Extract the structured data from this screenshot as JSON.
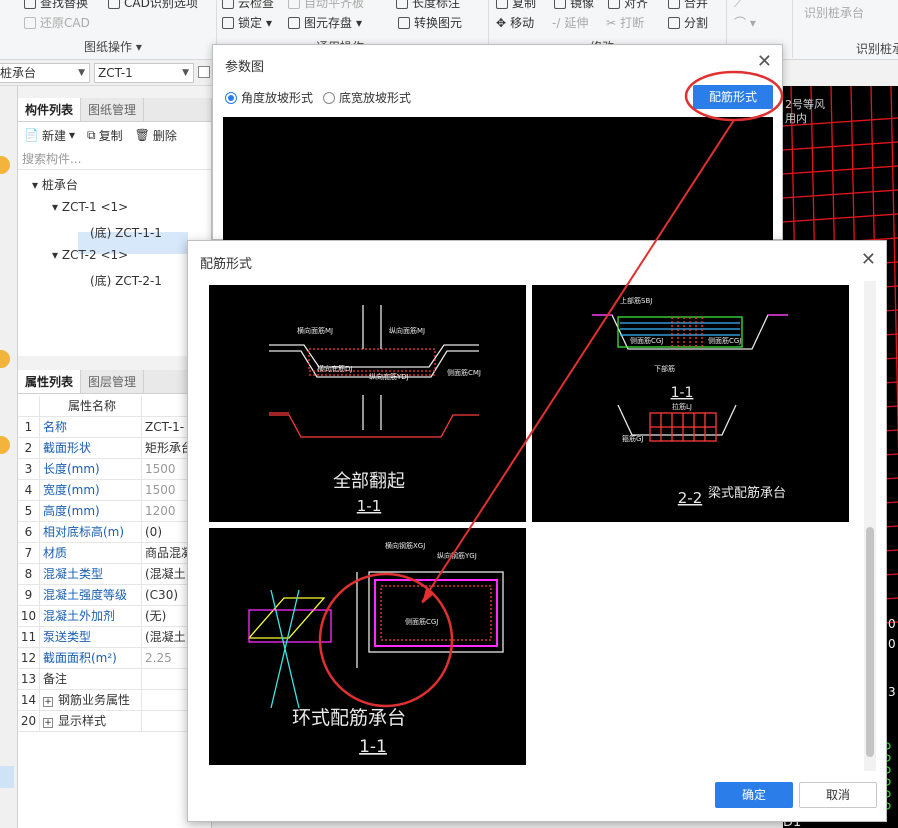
{
  "ribbon": {
    "find_replace": "查找替换",
    "restore_cad": "还原CAD",
    "cad_options": "CAD识别选项",
    "drawing_ops_label": "图纸操作",
    "cloud_check": "云检查",
    "auto_balance": "自动平齐板",
    "length_mark": "长度标注",
    "lock": "锁定",
    "element_save": "图元存盘",
    "convert_element": "转换图元",
    "general_ops_label": "通用操作",
    "copy": "复制",
    "mirror": "镜像",
    "align": "对齐",
    "merge": "合并",
    "move": "移动",
    "extend": "延伸",
    "break": "打断",
    "split": "分割",
    "modify_label": "修改",
    "recognize_pile_cap": "识别桩承台",
    "recognize_pile_label": "识别桩承"
  },
  "selector": {
    "category": "桩承台",
    "element": "ZCT-1"
  },
  "component_panel": {
    "tab_list": "构件列表",
    "tab_drawing": "图纸管理",
    "new_btn": "新建",
    "copy_btn": "复制",
    "delete_btn": "删除",
    "search_placeholder": "搜索构件...",
    "tree": {
      "root": "桩承台",
      "g1": "ZCT-1 <1>",
      "g1_child": "(底) ZCT-1-1",
      "g2": "ZCT-2 <1>",
      "g2_child": "(底) ZCT-2-1"
    }
  },
  "property_panel": {
    "tab_props": "属性列表",
    "tab_layers": "图层管理",
    "header": "属性名称",
    "rows": [
      {
        "n": "1",
        "name": "名称",
        "value": "ZCT-1-"
      },
      {
        "n": "2",
        "name": "截面形状",
        "value": "矩形承台"
      },
      {
        "n": "3",
        "name": "长度(mm)",
        "value": "1500"
      },
      {
        "n": "4",
        "name": "宽度(mm)",
        "value": "1500"
      },
      {
        "n": "5",
        "name": "高度(mm)",
        "value": "1200"
      },
      {
        "n": "6",
        "name": "相对底标高(m)",
        "value": "(0)"
      },
      {
        "n": "7",
        "name": "材质",
        "value": "商品混凝"
      },
      {
        "n": "8",
        "name": "混凝土类型",
        "value": "(混凝土"
      },
      {
        "n": "9",
        "name": "混凝土强度等级",
        "value": "(C30)"
      },
      {
        "n": "10",
        "name": "混凝土外加剂",
        "value": "(无)"
      },
      {
        "n": "11",
        "name": "泵送类型",
        "value": "(混凝土"
      },
      {
        "n": "12",
        "name": "截面面积(m²)",
        "value": "2.25"
      },
      {
        "n": "13",
        "name": "备注",
        "value": ""
      },
      {
        "n": "14",
        "name": "钢筋业务属性",
        "value": ""
      },
      {
        "n": "20",
        "name": "显示样式",
        "value": ""
      }
    ]
  },
  "cad_canvas": {
    "label1": "2号等风",
    "label2": "用内",
    "side1": "0",
    "side2": "0",
    "side3": "3",
    "bottom": "D1"
  },
  "param_dialog": {
    "title": "参数图",
    "radio1": "角度放坡形式",
    "radio2": "底宽放坡形式",
    "rebar_form_btn": "配筋形式"
  },
  "rebar_dialog": {
    "title": "配筋形式",
    "ok": "确定",
    "cancel": "取消",
    "thumbs": {
      "t1_caption": "全部翻起",
      "t1_section": "1-1",
      "t1_labels": [
        "横向面筋MJ",
        "纵向面筋MJ",
        "横向底筋DJ",
        "纵向底筋YDJ",
        "侧面筋CMJ"
      ],
      "t2_section_a": "1-1",
      "t2_section_b": "2-2",
      "t2_caption": "梁式配筋承台",
      "t2_labels": [
        "上部筋SBJ",
        "侧面筋CGJ",
        "侧面筋CGJ",
        "下部筋",
        "拉筋LJ",
        "箍筋GJ"
      ],
      "t3_caption": "环式配筋承台",
      "t3_section": "1-1",
      "t3_labels": [
        "横向钢筋XGJ",
        "纵向钢筋YGJ",
        "侧面筋CGJ"
      ]
    }
  }
}
